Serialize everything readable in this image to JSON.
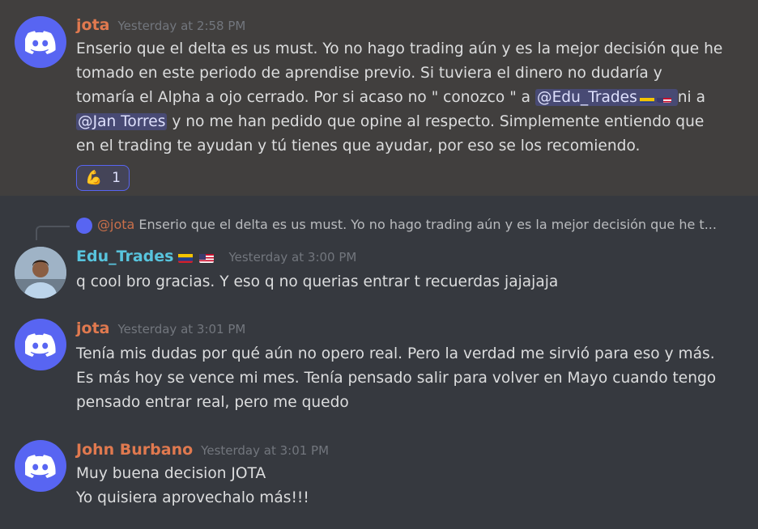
{
  "colors": {
    "jota": "#e0794f",
    "edu": "#58c4dd",
    "john": "#e0794f",
    "highlight_bg": "#413f3e",
    "mention_bg": "#4b5282"
  },
  "messages": [
    {
      "author": "jota",
      "timestamp": "Yesterday at 2:58 PM",
      "text_parts": [
        "Enserio que el delta es us must. Yo no hago trading aún y es la mejor decisión que he tomado en este periodo de aprendise previo. Si tuviera el dinero no dudaría y tomaría el Alpha a ojo cerrado. Por si acaso no \" conozco \" a ",
        "@Edu_Trades",
        " ni a ",
        "@Jan Torres",
        " y no me han pedido que opine al respecto. Simplemente entiendo que en el trading te ayudan y tú tienes que ayudar, por eso se los recomiendo."
      ],
      "reaction": {
        "emoji": "💪",
        "count": "1"
      }
    },
    {
      "reply_to": {
        "author": "@jota",
        "preview": "Enserio que el delta es us must. Yo no hago trading aún y es la mejor decisión que he t..."
      },
      "author": "Edu_Trades",
      "timestamp": "Yesterday at 3:00 PM",
      "text": "q cool bro gracias. Y eso q no querias entrar t recuerdas   jajajaja"
    },
    {
      "author": "jota",
      "timestamp": "Yesterday at 3:01 PM",
      "text": "Tenía mis dudas por qué aún no opero real. Pero la verdad me sirvió para eso y más. Es más hoy se vence mi mes. Tenía pensado salir para volver en Mayo cuando tengo pensado entrar real, pero me quedo"
    },
    {
      "author": "John Burbano",
      "timestamp": "Yesterday at 3:01 PM",
      "lines": [
        "Muy buena decision JOTA",
        "Yo quisiera aprovechalo más!!!"
      ]
    }
  ]
}
